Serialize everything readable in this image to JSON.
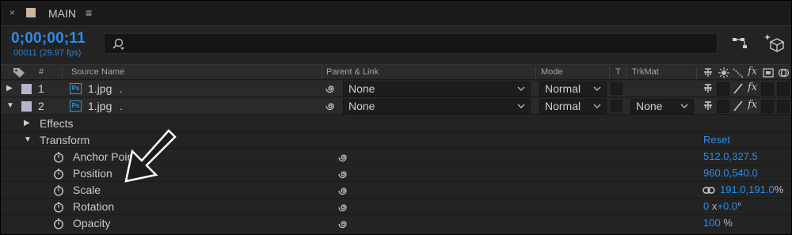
{
  "titlebar": {
    "close": "×",
    "title": "MAIN",
    "menu": "≡"
  },
  "time": {
    "timecode": "0;00;00;11",
    "frame_info": "00011 (29.97 fps)"
  },
  "search": {
    "placeholder": ""
  },
  "header": {
    "source_name": "Source Name",
    "num": "#",
    "parent_link": "Parent & Link",
    "mode": "Mode",
    "t": "T",
    "trkmat": "TrkMat"
  },
  "layers": [
    {
      "number": "1",
      "name": "1.jpg",
      "dot": ".",
      "ps": "Ps",
      "parent": "None",
      "mode": "Normal",
      "trkmat": ""
    },
    {
      "number": "2",
      "name": "1.jpg",
      "dot": ".",
      "ps": "Ps",
      "parent": "None",
      "mode": "Normal",
      "trkmat": "None"
    }
  ],
  "groups": {
    "effects": "Effects",
    "transform": "Transform",
    "reset": "Reset"
  },
  "properties": [
    {
      "name": "Anchor Point",
      "value": "512.0,327.5",
      "unit": ""
    },
    {
      "name": "Position",
      "value": "960.0,540.0",
      "unit": ""
    },
    {
      "name": "Scale",
      "value": "191.0,191.0",
      "unit": "%"
    },
    {
      "name": "Rotation",
      "value_a": "0",
      "x": "x",
      "value_b": "+0.0",
      "unit": "°"
    },
    {
      "name": "Opacity",
      "value": "100",
      "unit": "%"
    }
  ],
  "colors": {
    "accent": "#2d8ceb",
    "label": "#b7b5cf",
    "ps_icon": "#2b9be0",
    "title_swatch": "#c9b89a"
  }
}
